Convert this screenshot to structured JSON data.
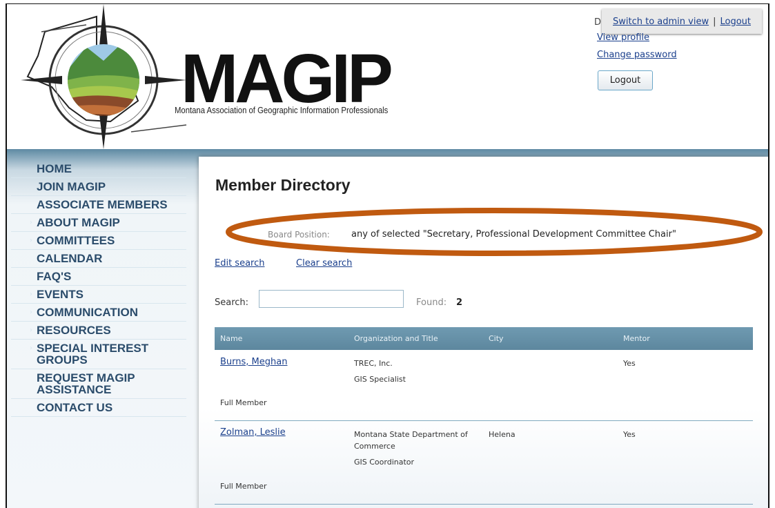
{
  "header": {
    "logo_word": "MAGIP",
    "logo_subtitle": "Montana Association of Geographic Information Professionals",
    "admin_bar": {
      "switch_label": "Switch to admin view",
      "separator": "|",
      "logout_label": "Logout"
    },
    "hidden_letter": "D",
    "view_profile": "View profile",
    "change_password": "Change password",
    "logout_button": "Logout"
  },
  "nav": {
    "items": [
      {
        "label": "HOME",
        "arrow": false
      },
      {
        "label": "JOIN MAGIP",
        "arrow": false
      },
      {
        "label": "ASSOCIATE MEMBERS",
        "arrow": false
      },
      {
        "label": "ABOUT MAGIP",
        "arrow": true
      },
      {
        "label": "COMMITTEES",
        "arrow": true
      },
      {
        "label": "CALENDAR",
        "arrow": false
      },
      {
        "label": "FAQ'S",
        "arrow": false
      },
      {
        "label": "EVENTS",
        "arrow": true
      },
      {
        "label": "COMMUNICATION",
        "arrow": true
      },
      {
        "label": "RESOURCES",
        "arrow": true
      },
      {
        "label": "SPECIAL INTEREST GROUPS",
        "arrow": true
      },
      {
        "label": "REQUEST MAGIP ASSISTANCE",
        "arrow": false
      },
      {
        "label": "CONTACT US",
        "arrow": false
      }
    ]
  },
  "main": {
    "title": "Member Directory",
    "criteria": {
      "label": "Board Position:",
      "value": "any of selected \"Secretary, Professional Development Committee Chair\""
    },
    "edit_search": "Edit search",
    "clear_search": "Clear search",
    "search": {
      "label": "Search:",
      "value": "",
      "placeholder": ""
    },
    "found": {
      "label": "Found:",
      "count": "2"
    },
    "table": {
      "columns": [
        "Name",
        "Organization and Title",
        "City",
        "Mentor"
      ],
      "rows": [
        {
          "name": "Burns, Meghan",
          "organization": "TREC, Inc.",
          "title": "GIS Specialist",
          "city": "",
          "mentor": "Yes",
          "level": "Full Member"
        },
        {
          "name": "Zolman, Leslie",
          "organization": "Montana State Department of Commerce",
          "title": "GIS Coordinator",
          "city": "Helena",
          "mentor": "Yes",
          "level": "Full Member"
        }
      ]
    }
  },
  "colors": {
    "brand_blue": "#2b4c6b",
    "link": "#1a3f8c",
    "highlight_ring": "#c05a10",
    "table_header": "#6a95ac"
  }
}
